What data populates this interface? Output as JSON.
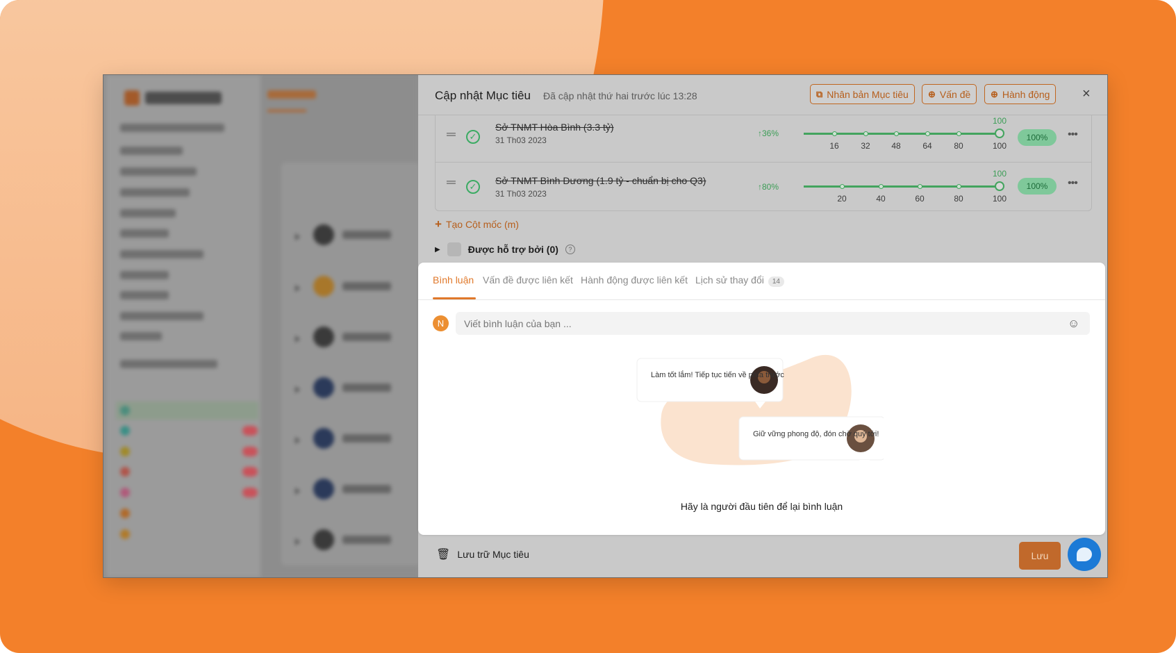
{
  "drawer": {
    "title": "Cập nhật Mục tiêu",
    "subtitle": "Đã cập nhật thứ hai trước lúc 13:28",
    "buttons": {
      "duplicate": "Nhân bản Mục tiêu",
      "issue": "Vấn đề",
      "action": "Hành động"
    },
    "close_icon": "×"
  },
  "milestones": [
    {
      "name": "Sở TNMT Hòa Bình (3.3 tỷ)",
      "date": "31 Th03 2023",
      "change": "↑36%",
      "ticks": [
        "16",
        "32",
        "48",
        "64",
        "80",
        "100"
      ],
      "target": "100",
      "progress": 1.0,
      "badge": "100%"
    },
    {
      "name": "Sở TNMT Bình Dương (1.9 tỷ - chuẩn bị cho Q3)",
      "date": "31 Th03 2023",
      "change": "↑80%",
      "ticks": [
        "20",
        "40",
        "60",
        "80",
        "100"
      ],
      "target": "100",
      "progress": 1.0,
      "badge": "100%"
    }
  ],
  "add_milestone": "Tạo Cột mốc (m)",
  "supported_by": "Được hỗ trợ bởi (0)",
  "comments": {
    "tabs": [
      {
        "label": "Bình luận"
      },
      {
        "label": "Vấn đề được liên kết"
      },
      {
        "label": "Hành động được liên kết"
      },
      {
        "label": "Lịch sử thay đổi",
        "count": "14"
      }
    ],
    "avatar_initial": "N",
    "placeholder": "Viết bình luận của bạn ...",
    "bubble1": "Làm tốt lắm! Tiếp tục tiến về phía trước",
    "bubble2": "Giữ vững phong độ, đón chờ quý tới!",
    "empty_text": "Hãy là người đầu tiên để lại bình luận"
  },
  "footer": {
    "archive": "Lưu trữ Mục tiêu",
    "save": "Lưu"
  },
  "colors": {
    "accent": "#E0782A",
    "success": "#43A45E",
    "background": "#F3802A",
    "chat": "#1C7AD6"
  }
}
